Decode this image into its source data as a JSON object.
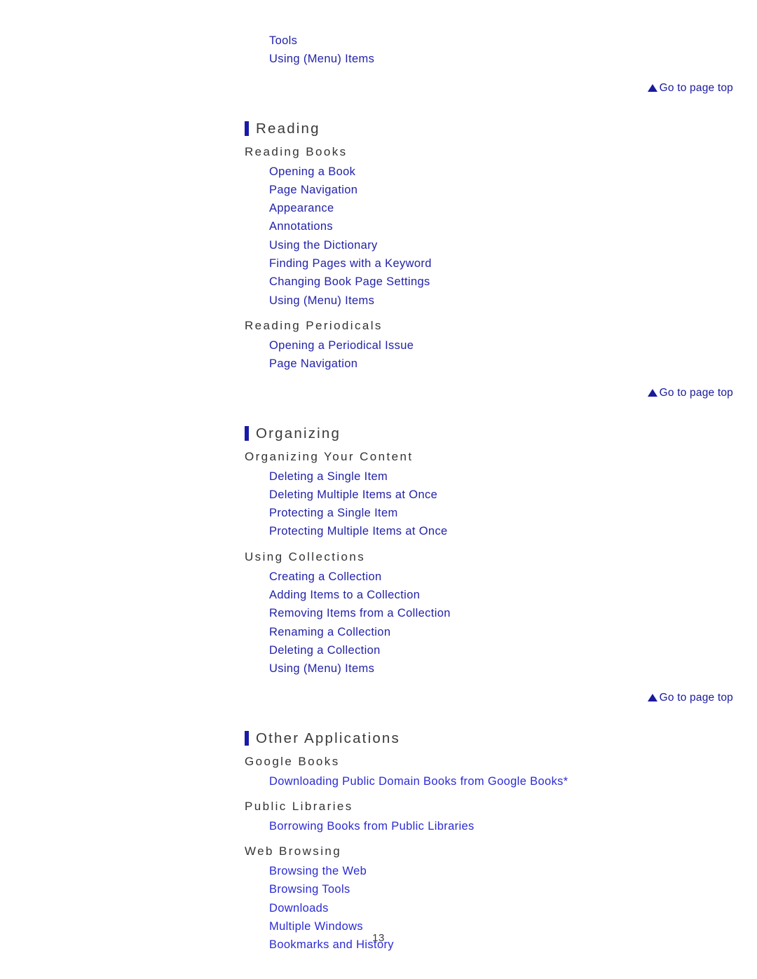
{
  "document": {
    "page_number": "13",
    "goto_top_label": "Go to page top",
    "accent_color": "#1a1aa8",
    "link_color": "#2222aa",
    "heading_color": "#3a3a3a"
  },
  "top_links": [
    {
      "label": "Tools"
    },
    {
      "label": "Using (Menu) Items"
    }
  ],
  "sections": [
    {
      "title": "Reading",
      "subsections": [
        {
          "title": "Reading Books",
          "links": [
            {
              "label": "Opening a Book"
            },
            {
              "label": "Page Navigation"
            },
            {
              "label": "Appearance"
            },
            {
              "label": "Annotations"
            },
            {
              "label": "Using the Dictionary"
            },
            {
              "label": "Finding Pages with a Keyword"
            },
            {
              "label": "Changing Book Page Settings"
            },
            {
              "label": "Using (Menu) Items"
            }
          ]
        },
        {
          "title": "Reading Periodicals",
          "links": [
            {
              "label": "Opening a Periodical Issue"
            },
            {
              "label": "Page Navigation"
            }
          ]
        }
      ]
    },
    {
      "title": "Organizing",
      "subsections": [
        {
          "title": "Organizing Your Content",
          "links": [
            {
              "label": "Deleting a Single Item"
            },
            {
              "label": "Deleting Multiple Items at Once"
            },
            {
              "label": "Protecting a Single Item"
            },
            {
              "label": "Protecting Multiple Items at Once"
            }
          ]
        },
        {
          "title": "Using Collections",
          "links": [
            {
              "label": "Creating a Collection"
            },
            {
              "label": "Adding Items to a Collection"
            },
            {
              "label": "Removing Items from a Collection"
            },
            {
              "label": "Renaming a Collection"
            },
            {
              "label": "Deleting a Collection"
            },
            {
              "label": "Using (Menu) Items"
            }
          ]
        }
      ]
    },
    {
      "title": "Other Applications",
      "subsections": [
        {
          "title": "Google Books",
          "links": [
            {
              "label": "Downloading Public Domain Books from Google Books*"
            }
          ]
        },
        {
          "title": "Public Libraries",
          "links": [
            {
              "label": "Borrowing Books from Public Libraries"
            }
          ]
        },
        {
          "title": "Web Browsing",
          "links": [
            {
              "label": "Browsing the Web"
            },
            {
              "label": "Browsing Tools"
            },
            {
              "label": "Downloads"
            },
            {
              "label": "Multiple Windows"
            },
            {
              "label": "Bookmarks and History"
            }
          ]
        }
      ]
    }
  ]
}
